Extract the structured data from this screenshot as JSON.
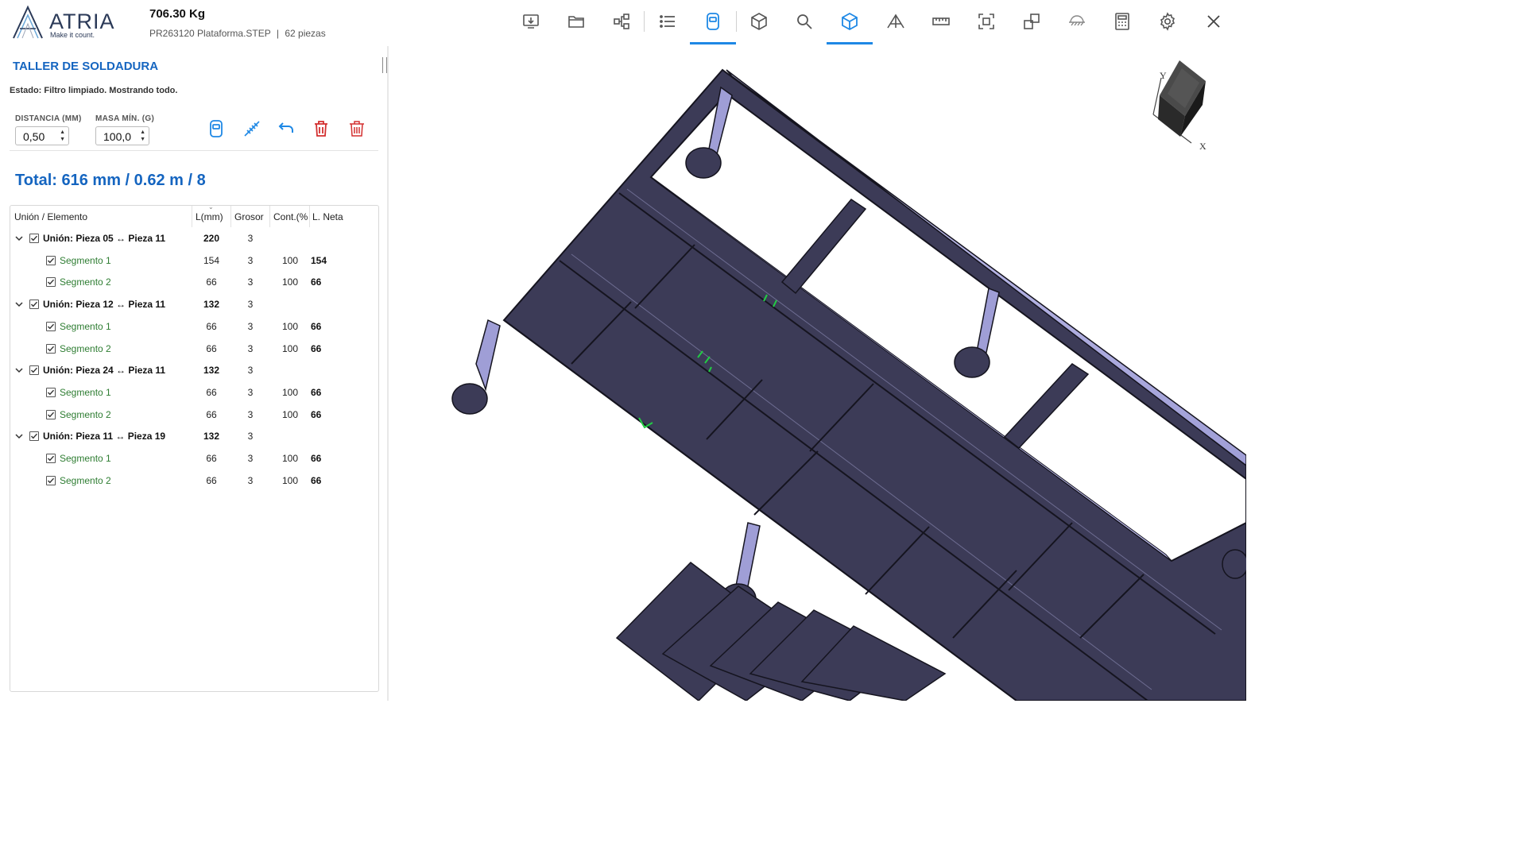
{
  "app": {
    "brand": "ATRIA",
    "tagline": "Make it count."
  },
  "document": {
    "weight": "706.30 Kg",
    "file": "PR263120 Plataforma.STEP",
    "pieces": "62 piezas",
    "sep": "|"
  },
  "toolbar": {
    "icons": [
      "import-icon",
      "folder-icon",
      "assembly-tree-icon",
      "list-icon",
      "weld-mask-icon",
      "box-view-icon",
      "zoom-icon",
      "cube-active-icon",
      "section-icon",
      "ruler-icon",
      "fit-view-icon",
      "shapes-icon",
      "plane-icon",
      "calculator-icon",
      "gear-icon",
      "close-icon"
    ],
    "active": [
      "weld-mask-icon",
      "cube-active-icon"
    ]
  },
  "panel": {
    "title": "TALLER DE SOLDADURA",
    "status": "Estado: Filtro limpiado. Mostrando todo.",
    "distance_label": "DISTANCIA (MM)",
    "distance_value": "0,50",
    "mass_label": "MASA MÍN. (G)",
    "mass_value": "100,0",
    "total": "Total: 616 mm / 0.62 m / 8",
    "actions": [
      "weld-mask-icon",
      "weld-seam-icon",
      "undo-icon",
      "delete-icon",
      "delete-all-icon"
    ]
  },
  "table": {
    "headers": {
      "element": "Unión / Elemento",
      "length": "L(mm)",
      "thickness": "Grosor",
      "cont": "Cont.(%",
      "net": "L. Neta"
    },
    "groups": [
      {
        "name": "Unión: Pieza 05 ↔ Pieza 11",
        "length": "220",
        "thickness": "3",
        "segments": [
          {
            "name": "Segmento 1",
            "length": "154",
            "thickness": "3",
            "cont": "100",
            "net": "154"
          },
          {
            "name": "Segmento 2",
            "length": "66",
            "thickness": "3",
            "cont": "100",
            "net": "66"
          }
        ]
      },
      {
        "name": "Unión: Pieza 12 ↔ Pieza 11",
        "length": "132",
        "thickness": "3",
        "segments": [
          {
            "name": "Segmento 1",
            "length": "66",
            "thickness": "3",
            "cont": "100",
            "net": "66"
          },
          {
            "name": "Segmento 2",
            "length": "66",
            "thickness": "3",
            "cont": "100",
            "net": "66"
          }
        ]
      },
      {
        "name": "Unión: Pieza 24 ↔ Pieza 11",
        "length": "132",
        "thickness": "3",
        "segments": [
          {
            "name": "Segmento 1",
            "length": "66",
            "thickness": "3",
            "cont": "100",
            "net": "66"
          },
          {
            "name": "Segmento 2",
            "length": "66",
            "thickness": "3",
            "cont": "100",
            "net": "66"
          }
        ]
      },
      {
        "name": "Unión: Pieza 11 ↔ Pieza 19",
        "length": "132",
        "thickness": "3",
        "segments": [
          {
            "name": "Segmento 1",
            "length": "66",
            "thickness": "3",
            "cont": "100",
            "net": "66"
          },
          {
            "name": "Segmento 2",
            "length": "66",
            "thickness": "3",
            "cont": "100",
            "net": "66"
          }
        ]
      }
    ]
  },
  "viewcube": {
    "axis_y": "Y",
    "axis_x": "X"
  },
  "colors": {
    "accent": "#1565c0",
    "active_tab": "#1e88e5",
    "segment_text": "#2e7d32",
    "model_fill": "#3b3a55",
    "model_highlight": "#b9b8e8",
    "weld_mark": "#22cc44",
    "delete": "#d32f2f"
  }
}
